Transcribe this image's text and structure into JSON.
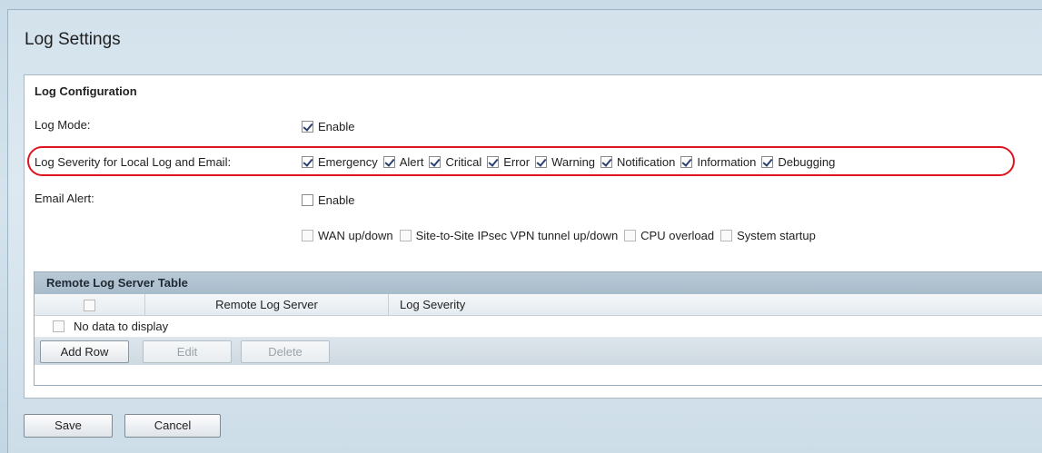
{
  "page": {
    "title": "Log Settings"
  },
  "log_configuration": {
    "heading": "Log Configuration",
    "log_mode": {
      "label": "Log Mode:",
      "enable_label": "Enable",
      "enabled": true
    },
    "severity": {
      "label": "Log Severity for Local Log and Email:",
      "options": [
        {
          "label": "Emergency",
          "checked": true
        },
        {
          "label": "Alert",
          "checked": true
        },
        {
          "label": "Critical",
          "checked": true
        },
        {
          "label": "Error",
          "checked": true
        },
        {
          "label": "Warning",
          "checked": true
        },
        {
          "label": "Notification",
          "checked": true
        },
        {
          "label": "Information",
          "checked": true
        },
        {
          "label": "Debugging",
          "checked": true
        }
      ]
    },
    "email_alert": {
      "label": "Email Alert:",
      "enable_label": "Enable",
      "enabled": false,
      "events": [
        {
          "label": "WAN up/down",
          "checked": false
        },
        {
          "label": "Site-to-Site IPsec VPN tunnel up/down",
          "checked": false
        },
        {
          "label": "CPU overload",
          "checked": false
        },
        {
          "label": "System startup",
          "checked": false
        }
      ]
    }
  },
  "remote_log_table": {
    "title": "Remote Log Server Table",
    "columns": [
      "",
      "Remote Log Server",
      "Log Severity"
    ],
    "empty_text": "No data to display",
    "buttons": {
      "add": "Add Row",
      "edit": "Edit",
      "delete": "Delete"
    }
  },
  "actions": {
    "save": "Save",
    "cancel": "Cancel"
  },
  "colors": {
    "highlight": "#e0141e",
    "check": "#2a3f73",
    "header_bar": "#b9c9d6"
  }
}
